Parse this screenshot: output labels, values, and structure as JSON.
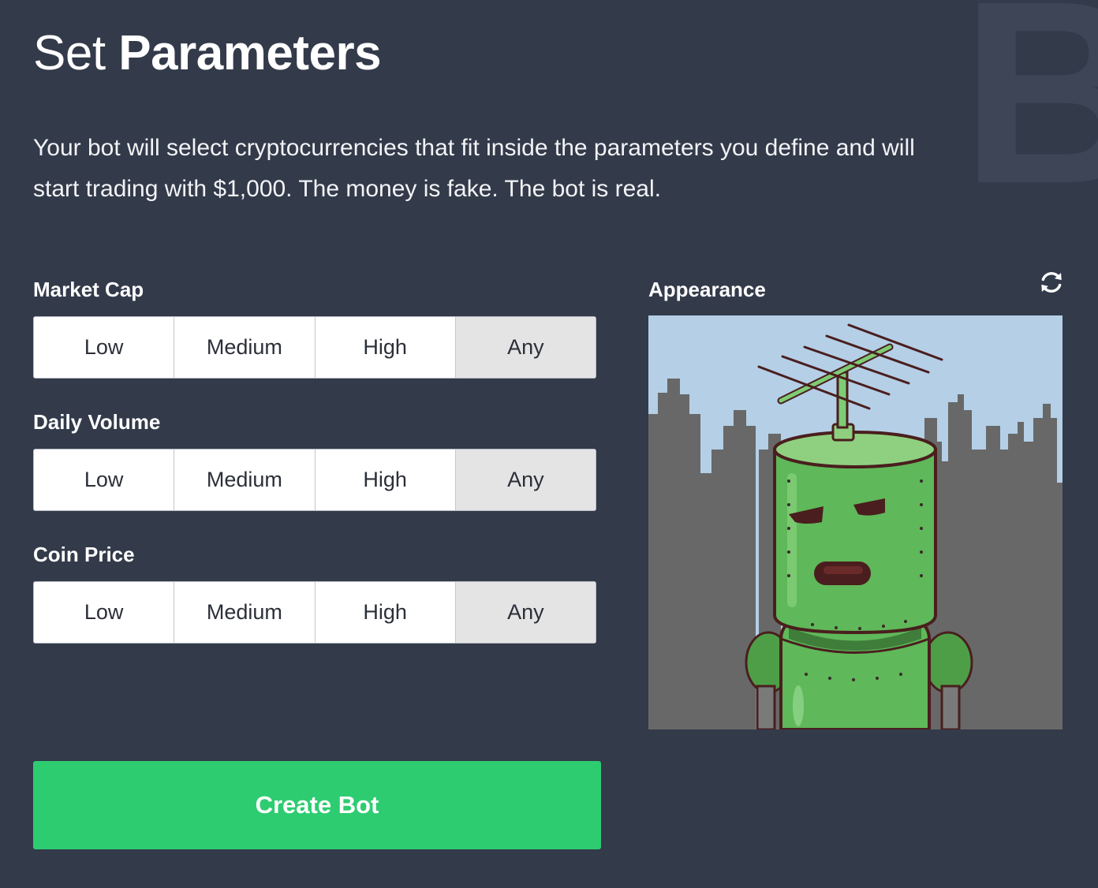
{
  "background_letter": "B",
  "header": {
    "title_light": "Set",
    "title_bold": "Parameters"
  },
  "description": "Your bot will select cryptocurrencies that fit inside the parameters you define and will start trading with $1,000. The money is fake. The bot is real.",
  "parameters": [
    {
      "label": "Market Cap",
      "options": [
        "Low",
        "Medium",
        "High",
        "Any"
      ],
      "selected": "Any"
    },
    {
      "label": "Daily Volume",
      "options": [
        "Low",
        "Medium",
        "High",
        "Any"
      ],
      "selected": "Any"
    },
    {
      "label": "Coin Price",
      "options": [
        "Low",
        "Medium",
        "High",
        "Any"
      ],
      "selected": "Any"
    }
  ],
  "appearance": {
    "label": "Appearance",
    "refresh_icon": "refresh-icon",
    "image_subject": "robot-avatar"
  },
  "create_button": "Create Bot",
  "colors": {
    "background": "#333a4a",
    "accent_green": "#2ecc71",
    "selected_option": "#e4e4e4",
    "robot_green": "#5fb859",
    "sky": "#b4cfe6",
    "city": "#686868"
  }
}
